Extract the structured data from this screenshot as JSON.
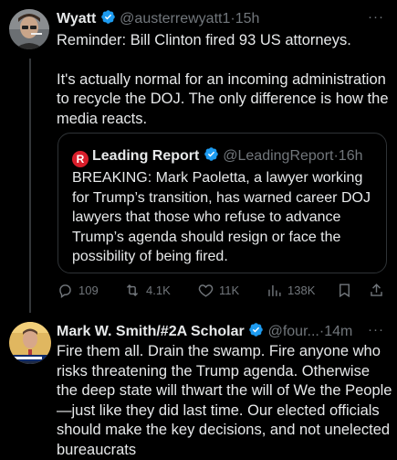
{
  "tweet1": {
    "name": "Wyatt",
    "handle": "@austerrewyatt1",
    "time": "15h",
    "text_para1": "Reminder: Bill Clinton fired 93 US attorneys.",
    "text_para2": "It's actually normal for an incoming administration to recycle the DOJ. The only difference is how the media reacts.",
    "quote": {
      "logo_letter": "R",
      "name": "Leading Report",
      "handle": "@LeadingReport",
      "time": "16h",
      "text": "BREAKING: Mark Paoletta, a lawyer working for Trump’s transition, has warned career DOJ lawyers that those who refuse to advance Trump’s agenda should resign or face the possibility of being fired."
    },
    "actions": {
      "replies": "109",
      "reposts": "4.1K",
      "likes": "11K",
      "views": "138K"
    }
  },
  "tweet2": {
    "name": "Mark W. Smith/#2A Scholar",
    "handle": "@four...",
    "time": "14m",
    "text": "Fire them all.  Drain the swamp. Fire anyone who risks threatening the Trump agenda.  Otherwise the deep state will thwart the will of We the People—just like they did last time.  Our elected officials should make the key decisions, and not unelected bureaucrats"
  },
  "separator": "·",
  "more_label": "···",
  "colors": {
    "background": "#000000",
    "text": "#e7e9ea",
    "muted": "#71767b",
    "verified": "#1d9bf0",
    "leading_report_red": "#d91e2b"
  },
  "icons": [
    "reply-icon",
    "repost-icon",
    "like-icon",
    "views-icon",
    "bookmark-icon",
    "share-icon",
    "verified-icon"
  ]
}
